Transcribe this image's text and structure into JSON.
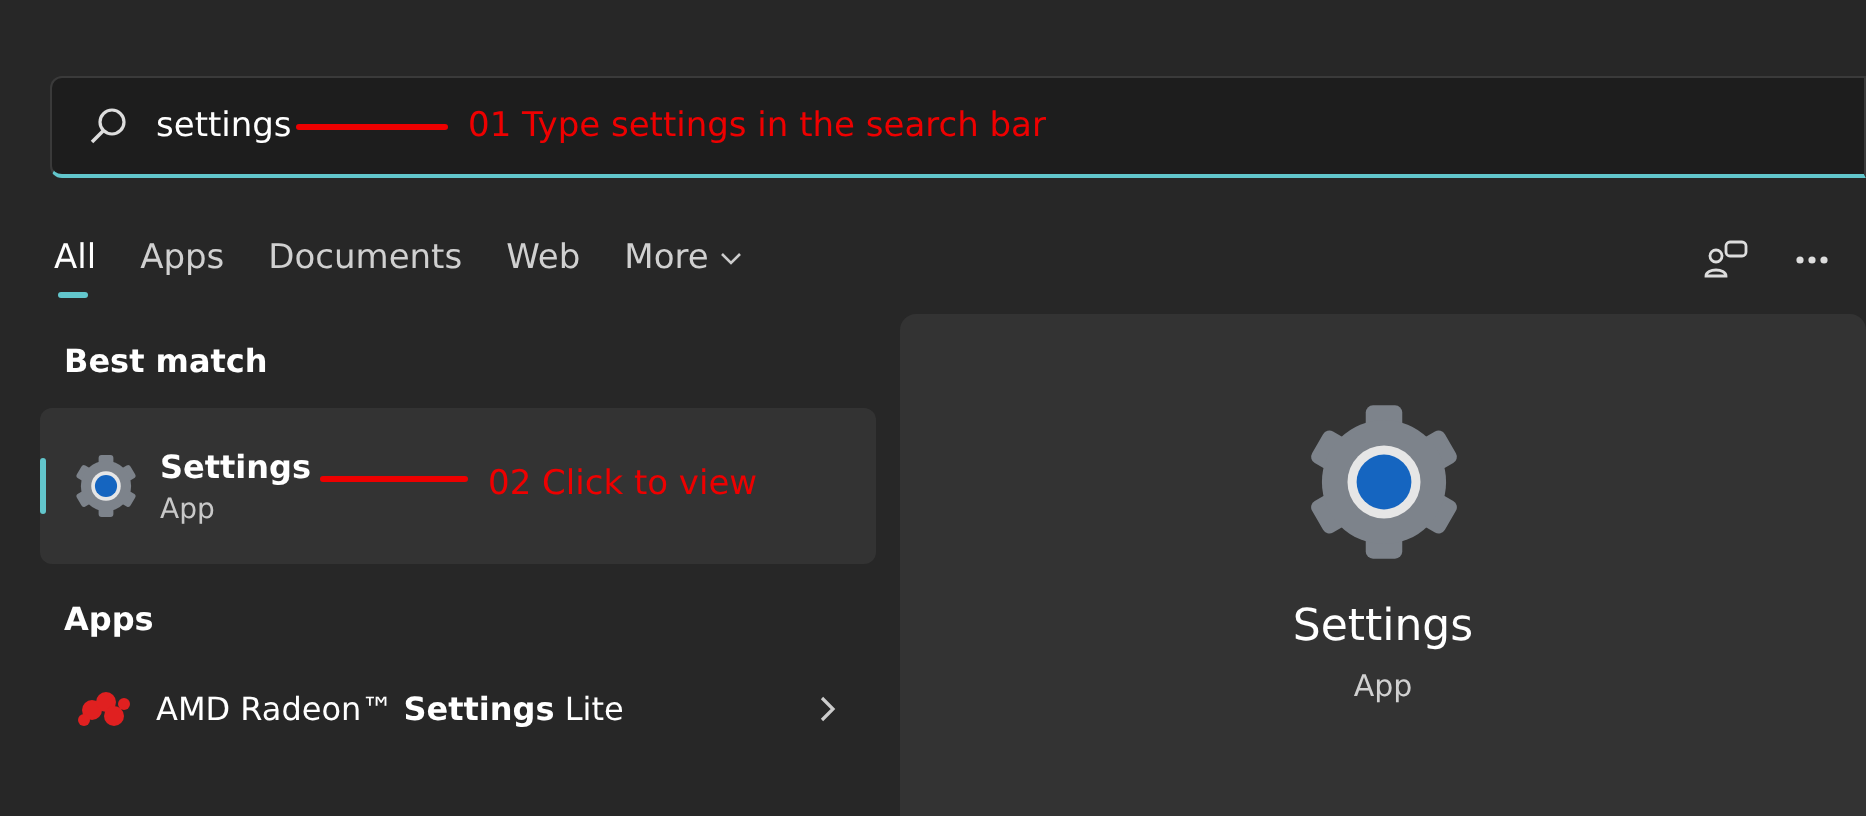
{
  "search": {
    "value": "settings",
    "annotation": "01 Type settings in the search bar"
  },
  "tabs": [
    {
      "label": "All",
      "selected": true,
      "kind": "filter"
    },
    {
      "label": "Apps",
      "selected": false,
      "kind": "filter"
    },
    {
      "label": "Documents",
      "selected": false,
      "kind": "filter"
    },
    {
      "label": "Web",
      "selected": false,
      "kind": "filter"
    },
    {
      "label": "More",
      "selected": false,
      "kind": "menu"
    }
  ],
  "best_match": {
    "heading": "Best match",
    "title": "Settings",
    "subtitle": "App",
    "selected": true,
    "annotation": "02 Click to view"
  },
  "apps": {
    "heading": "Apps",
    "items": [
      {
        "label": "AMD Radeon™ **Settings** Lite"
      }
    ]
  },
  "preview": {
    "title": "Settings",
    "subtitle": "App"
  }
}
